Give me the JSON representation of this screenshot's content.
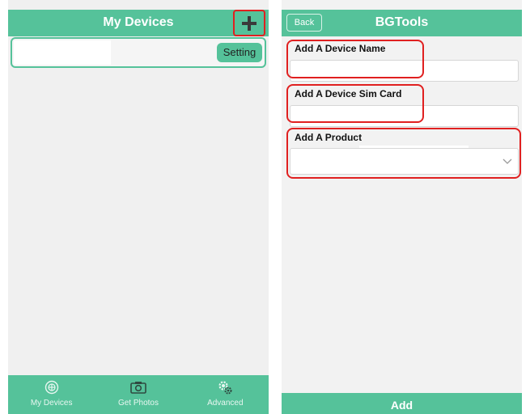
{
  "left_screen": {
    "title": "My Devices",
    "add_icon": "plus-icon",
    "device_row": {
      "setting_label": "Setting"
    },
    "tabs": [
      {
        "label": "My Devices",
        "icon": "compass-icon"
      },
      {
        "label": "Get Photos",
        "icon": "camera-icon"
      },
      {
        "label": "Advanced",
        "icon": "gear-icon"
      }
    ]
  },
  "right_screen": {
    "title": "BGTools",
    "back_label": "Back",
    "fields": {
      "device_name": {
        "label": "Add A Device Name",
        "value": ""
      },
      "sim_card": {
        "label": "Add A Device Sim Card",
        "value": ""
      },
      "product": {
        "label": "Add A Product",
        "selected": ""
      }
    },
    "add_label": "Add"
  },
  "colors": {
    "primary": "#55c29a",
    "highlight": "#e02020",
    "background": "#f0f0f0"
  }
}
